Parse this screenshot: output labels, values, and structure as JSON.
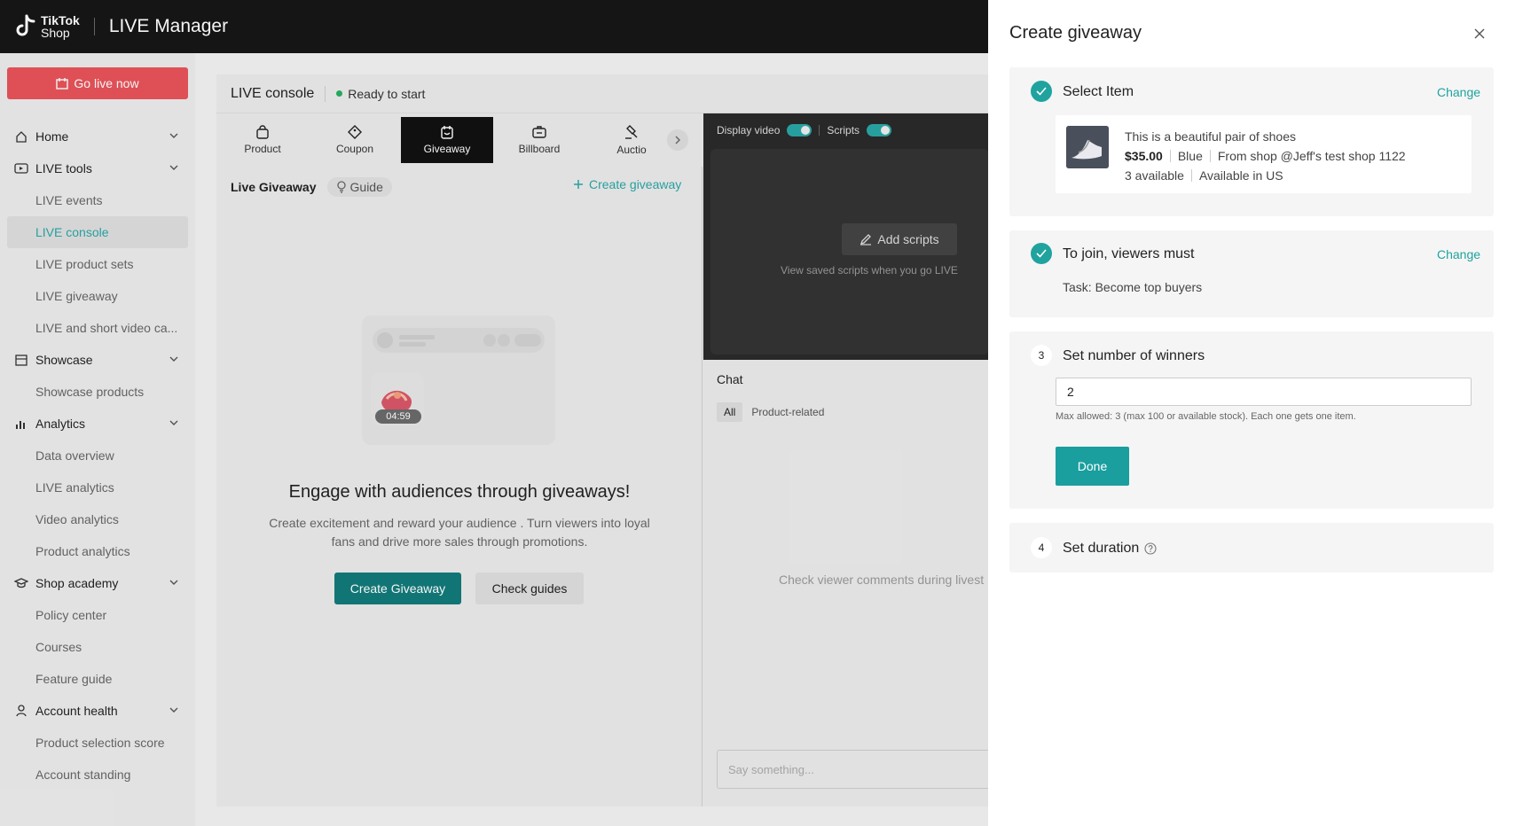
{
  "header": {
    "logo_line1": "TikTok",
    "logo_line2": "Shop",
    "title": "LIVE Manager"
  },
  "sidebar": {
    "go_live_label": "Go live now",
    "items": [
      {
        "label": "Home",
        "type": "parent",
        "icon": "home-icon"
      },
      {
        "label": "LIVE tools",
        "type": "parent",
        "icon": "live-tools-icon"
      },
      {
        "label": "LIVE events",
        "type": "child"
      },
      {
        "label": "LIVE console",
        "type": "child",
        "active": true
      },
      {
        "label": "LIVE product sets",
        "type": "child"
      },
      {
        "label": "LIVE giveaway",
        "type": "child"
      },
      {
        "label": "LIVE and short video ca...",
        "type": "child"
      },
      {
        "label": "Showcase",
        "type": "parent",
        "icon": "showcase-icon"
      },
      {
        "label": "Showcase products",
        "type": "child"
      },
      {
        "label": "Analytics",
        "type": "parent",
        "icon": "analytics-icon"
      },
      {
        "label": "Data overview",
        "type": "child"
      },
      {
        "label": "LIVE analytics",
        "type": "child"
      },
      {
        "label": "Video analytics",
        "type": "child"
      },
      {
        "label": "Product analytics",
        "type": "child"
      },
      {
        "label": "Shop academy",
        "type": "parent",
        "icon": "academy-icon"
      },
      {
        "label": "Policy center",
        "type": "child"
      },
      {
        "label": "Courses",
        "type": "child"
      },
      {
        "label": "Feature guide",
        "type": "child"
      },
      {
        "label": "Account health",
        "type": "parent",
        "icon": "user-icon"
      },
      {
        "label": "Product selection score",
        "type": "child"
      },
      {
        "label": "Account standing",
        "type": "child"
      }
    ]
  },
  "console": {
    "title": "LIVE console",
    "status": "Ready to start",
    "status_color": "#27ae60",
    "tabs": [
      {
        "label": "Product",
        "icon": "bag-icon"
      },
      {
        "label": "Coupon",
        "icon": "coupon-icon"
      },
      {
        "label": "Giveaway",
        "icon": "giveaway-icon",
        "active": true
      },
      {
        "label": "Billboard",
        "icon": "billboard-icon"
      },
      {
        "label": "Auctio",
        "icon": "auction-icon"
      }
    ],
    "giveaway_title": "Live Giveaway",
    "guide_label": "Guide",
    "create_link": "Create giveaway",
    "timer": "04:59",
    "engage_title": "Engage with audiences through giveaways!",
    "engage_desc": "Create excitement and reward your audience . Turn viewers into loyal fans and drive more sales through  promotions.",
    "create_button": "Create Giveaway",
    "check_button": "Check guides"
  },
  "scripts_panel": {
    "display_video_label": "Display video",
    "scripts_label": "Scripts",
    "add_scripts": "Add scripts",
    "hint": "View saved scripts when you go LIVE"
  },
  "chat": {
    "title": "Chat",
    "tab_all": "All",
    "tab_product": "Product-related",
    "empty": "Check viewer comments during livest",
    "input_placeholder": "Say something..."
  },
  "drawer": {
    "title": "Create giveaway",
    "step1": {
      "title": "Select Item",
      "change": "Change",
      "item_name": "This is a beautiful pair of shoes",
      "price": "$35.00",
      "color": "Blue",
      "shop": "From shop @Jeff's test shop 1122",
      "available": "3 available",
      "region": "Available in US"
    },
    "step2": {
      "title": "To join, viewers must",
      "change": "Change",
      "task": "Task: Become top buyers"
    },
    "step3": {
      "number": "3",
      "title": "Set number of winners",
      "value": "2",
      "help": "Max allowed: 3 (max 100 or available stock). Each one gets one item.",
      "done": "Done"
    },
    "step4": {
      "number": "4",
      "title": "Set duration"
    },
    "accent_color": "#20a39e"
  }
}
